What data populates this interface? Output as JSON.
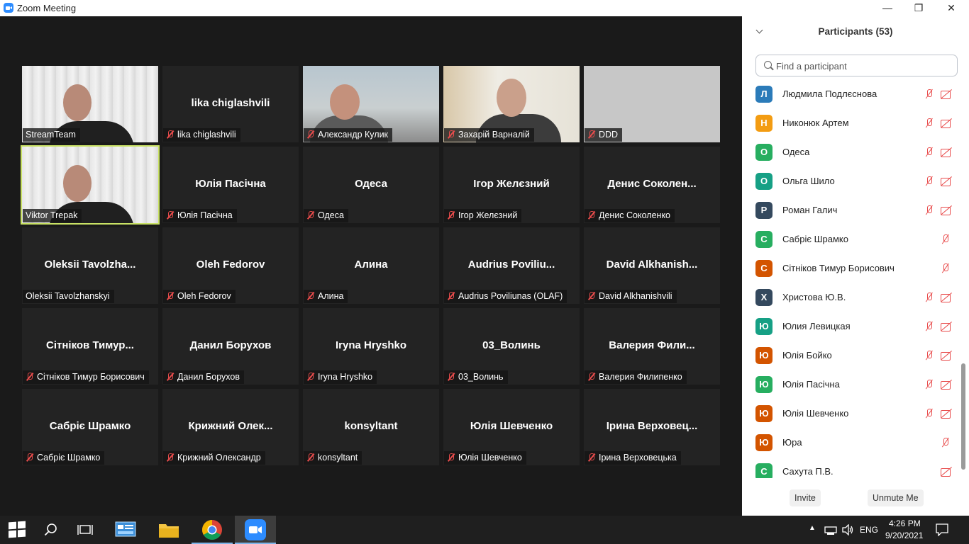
{
  "window": {
    "title": "Zoom Meeting",
    "minimize": "—",
    "restore": "❐",
    "close": "✕"
  },
  "colors": {
    "panel_bg": "#ffffff",
    "stage_bg": "#1a1a1a",
    "active_speaker": "#c9e265",
    "muted_red": "#e84c4c"
  },
  "tiles": [
    {
      "name": "StreamTeam",
      "label": "StreamTeam",
      "muted": false,
      "video": true,
      "active": false
    },
    {
      "name": "lika chiglashvili",
      "label": "lika chiglashvili",
      "muted": true,
      "video": false,
      "active": false
    },
    {
      "name": "Александр Кулик",
      "label": "Александр Кулик",
      "muted": true,
      "video": true,
      "active": false
    },
    {
      "name": "Захарій Варналій",
      "label": "Захарій Варналій",
      "muted": true,
      "video": true,
      "active": false
    },
    {
      "name": "DDD",
      "label": "DDD",
      "muted": true,
      "video": true,
      "active": false
    },
    {
      "name": "Viktor Trepak",
      "label": "Viktor Trepak",
      "muted": false,
      "video": true,
      "active": true
    },
    {
      "name": "Юлія Пасічна",
      "label": "Юлія Пасічна",
      "muted": true,
      "video": false,
      "active": false
    },
    {
      "name": "Одеса",
      "label": "Одеса",
      "muted": true,
      "video": false,
      "active": false
    },
    {
      "name": "Ігор Желєзний",
      "label": "Ігор Желєзний",
      "muted": true,
      "video": false,
      "active": false
    },
    {
      "name": "Денис Соколен...",
      "label": "Денис Соколенко",
      "muted": true,
      "video": false,
      "active": false
    },
    {
      "name": "Oleksii Tavolzha...",
      "label": "Oleksii Tavolzhanskyi",
      "muted": false,
      "video": false,
      "active": false
    },
    {
      "name": "Oleh Fedorov",
      "label": "Oleh Fedorov",
      "muted": true,
      "video": false,
      "active": false
    },
    {
      "name": "Алина",
      "label": "Алина",
      "muted": true,
      "video": false,
      "active": false
    },
    {
      "name": "Audrius Poviliu...",
      "label": "Audrius Poviliunas (OLAF)",
      "muted": true,
      "video": false,
      "active": false
    },
    {
      "name": "David Alkhanish...",
      "label": "David Alkhanishvili",
      "muted": true,
      "video": false,
      "active": false
    },
    {
      "name": "Сітніков Тимур...",
      "label": "Сітніков Тимур Борисович",
      "muted": true,
      "video": false,
      "active": false
    },
    {
      "name": "Данил Борухов",
      "label": "Данил Борухов",
      "muted": true,
      "video": false,
      "active": false
    },
    {
      "name": "Iryna Hryshko",
      "label": "Iryna Hryshko",
      "muted": true,
      "video": false,
      "active": false
    },
    {
      "name": "03_Волинь",
      "label": "03_Волинь",
      "muted": true,
      "video": false,
      "active": false
    },
    {
      "name": "Валерия Фили...",
      "label": "Валерия Филипенко",
      "muted": true,
      "video": false,
      "active": false
    },
    {
      "name": "Сабріє Шрамко",
      "label": "Сабріє Шрамко",
      "muted": true,
      "video": false,
      "active": false
    },
    {
      "name": "Крижний Олек...",
      "label": "Крижний Олександр",
      "muted": true,
      "video": false,
      "active": false
    },
    {
      "name": "konsyltant",
      "label": "konsyltant",
      "muted": true,
      "video": false,
      "active": false
    },
    {
      "name": "Юлія Шевченко",
      "label": "Юлія Шевченко",
      "muted": true,
      "video": false,
      "active": false
    },
    {
      "name": "Ірина Верховец...",
      "label": "Ірина Верховецька",
      "muted": true,
      "video": false,
      "active": false
    }
  ],
  "participants_panel": {
    "title": "Participants (53)",
    "search_placeholder": "Find a participant",
    "items": [
      {
        "initial": "Л",
        "name": "Людмила Подлєснова",
        "color": "#2b7bb9",
        "mic_off": true,
        "cam_off": true
      },
      {
        "initial": "Н",
        "name": "Никонюк Артем",
        "color": "#f39c12",
        "mic_off": true,
        "cam_off": true
      },
      {
        "initial": "О",
        "name": "Одеса",
        "color": "#27ae60",
        "mic_off": true,
        "cam_off": true
      },
      {
        "initial": "О",
        "name": "Ольга Шило",
        "color": "#16a085",
        "mic_off": true,
        "cam_off": true
      },
      {
        "initial": "Р",
        "name": "Роман Галич",
        "color": "#34495e",
        "mic_off": true,
        "cam_off": true
      },
      {
        "initial": "С",
        "name": "Сабріє Шрамко",
        "color": "#27ae60",
        "mic_off": true,
        "cam_off": false
      },
      {
        "initial": "С",
        "name": "Сітніков Тимур Борисович",
        "color": "#d35400",
        "mic_off": true,
        "cam_off": false
      },
      {
        "initial": "Х",
        "name": "Христова Ю.В.",
        "color": "#34495e",
        "mic_off": true,
        "cam_off": true
      },
      {
        "initial": "Ю",
        "name": "Юлия Левицкая",
        "color": "#16a085",
        "mic_off": true,
        "cam_off": true
      },
      {
        "initial": "Ю",
        "name": "Юлія Бойко",
        "color": "#d35400",
        "mic_off": true,
        "cam_off": true
      },
      {
        "initial": "Ю",
        "name": "Юлія Пасічна",
        "color": "#27ae60",
        "mic_off": true,
        "cam_off": true
      },
      {
        "initial": "Ю",
        "name": "Юлія Шевченко",
        "color": "#d35400",
        "mic_off": true,
        "cam_off": true
      },
      {
        "initial": "Ю",
        "name": "Юра",
        "color": "#d35400",
        "mic_off": true,
        "cam_off": false
      },
      {
        "initial": "С",
        "name": "Сахута П.В.",
        "color": "#27ae60",
        "mic_off": false,
        "cam_off": true
      }
    ],
    "invite_label": "Invite",
    "unmute_label": "Unmute Me"
  },
  "taskbar": {
    "language": "ENG",
    "time": "4:26 PM",
    "date": "9/20/2021",
    "apps": [
      "search-icon",
      "task-view-icon",
      "control-panel-icon",
      "file-explorer-icon",
      "chrome-icon",
      "zoom-icon"
    ]
  }
}
